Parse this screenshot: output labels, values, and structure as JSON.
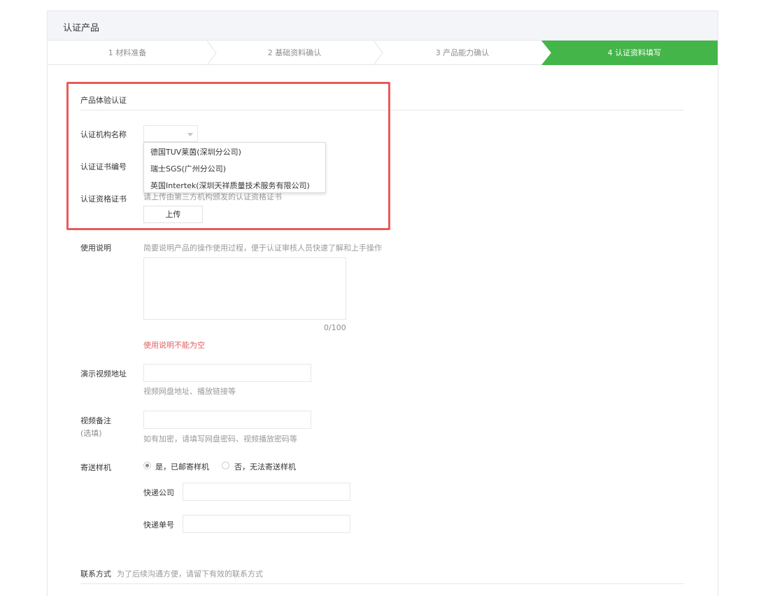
{
  "panel": {
    "title": "认证产品"
  },
  "steps": [
    {
      "label": "1 材料准备",
      "active": false
    },
    {
      "label": "2 基础资料确认",
      "active": false
    },
    {
      "label": "3 产品能力确认",
      "active": false
    },
    {
      "label": "4 认证资料填写",
      "active": true
    }
  ],
  "colors": {
    "accent": "#44b549",
    "highlight": "#e95a5a",
    "error": "#e15f63"
  },
  "experience_section": {
    "title": "产品体验认证",
    "org_label": "认证机构名称",
    "org_options": [
      "德国TUV莱茵(深圳分公司)",
      "瑞士SGS(广州分公司)",
      "英国Intertek(深圳天祥质量技术服务有限公司)"
    ],
    "cert_no_label": "认证证书编号",
    "cert_label": "认证资格证书",
    "cert_tip": "请上传由第三方机构颁发的认证资格证书",
    "upload_label": "上传"
  },
  "usage": {
    "label": "使用说明",
    "tip": "简要说明产品的操作使用过程，便于认证审核人员快速了解和上手操作",
    "counter": "0/100",
    "error": "使用说明不能为空"
  },
  "video_url": {
    "label": "演示视频地址",
    "tip": "视频网盘地址、播放链接等"
  },
  "video_note": {
    "label": "视频备注",
    "sublabel": "(选填)",
    "tip": "如有加密，请填写网盘密码、视频播放密码等"
  },
  "sample": {
    "label": "寄送样机",
    "option_yes": "是，已邮寄样机",
    "option_no": "否，无法寄送样机",
    "selected": "yes",
    "courier_label": "快递公司",
    "tracking_label": "快递单号"
  },
  "contact": {
    "title": "联系方式",
    "tip": "为了后续沟通方便，请留下有效的联系方式"
  }
}
